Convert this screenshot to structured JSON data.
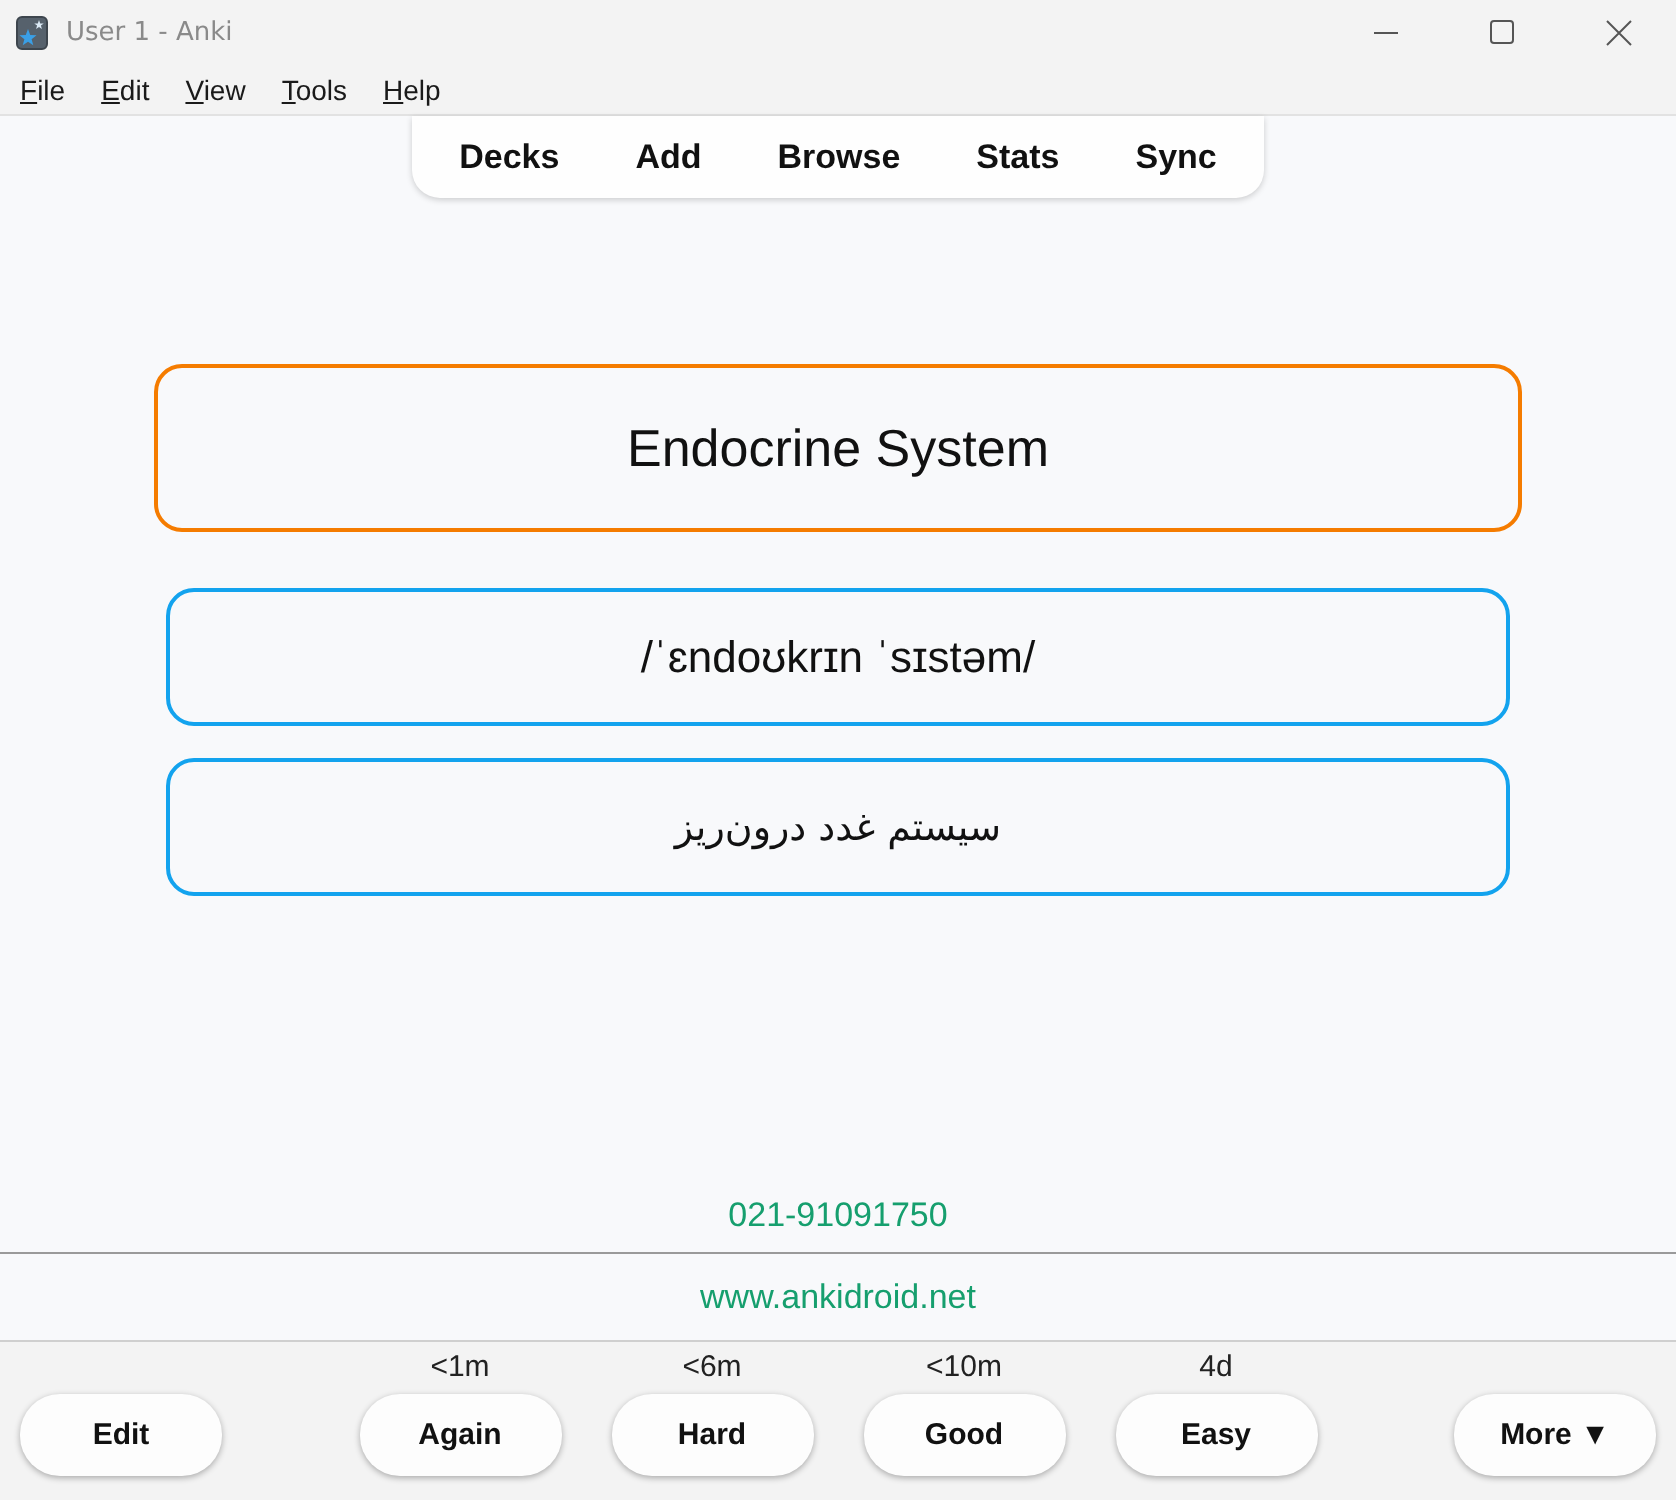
{
  "window": {
    "title": "User 1 - Anki"
  },
  "menu": [
    {
      "label": "File",
      "underlined_mnemonic": true
    },
    {
      "label": "Edit",
      "underlined_mnemonic": true
    },
    {
      "label": "View",
      "underlined_mnemonic": true
    },
    {
      "label": "Tools",
      "underlined_mnemonic": true
    },
    {
      "label": "Help",
      "underlined_mnemonic": true
    }
  ],
  "toolbar": [
    "Decks",
    "Add",
    "Browse",
    "Stats",
    "Sync"
  ],
  "card": {
    "fields": [
      {
        "kind": "term",
        "text": "Endocrine System",
        "color": "#f57c00"
      },
      {
        "kind": "pronunciation",
        "text": "/ˈɛndoʊkrɪn ˈsɪstəm/",
        "color": "#13a3ee"
      },
      {
        "kind": "translation",
        "text": "سیستم غدد درون‌ریز",
        "color": "#13a3ee"
      }
    ],
    "phone": "021-91091750"
  },
  "link_bar": {
    "link": "www.ankidroid.net"
  },
  "bottom_bar": {
    "left_button": "Edit",
    "answer_buttons": [
      {
        "interval": "<1m",
        "label": "Again"
      },
      {
        "interval": "<6m",
        "label": "Hard"
      },
      {
        "interval": "<10m",
        "label": "Good"
      },
      {
        "interval": "4d",
        "label": "Easy"
      }
    ],
    "right_button": "More ▼"
  }
}
